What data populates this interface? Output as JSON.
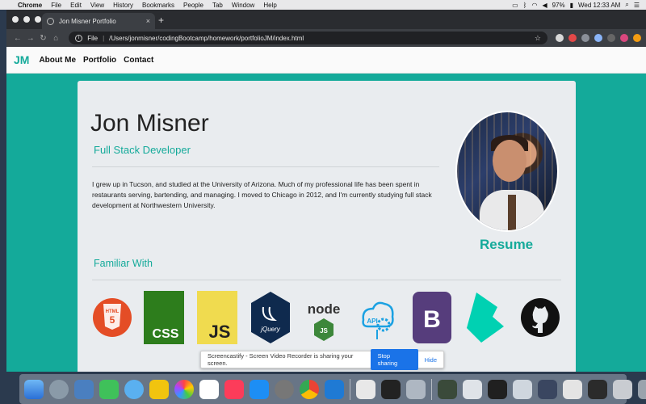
{
  "menubar": {
    "apple": "",
    "items": [
      "Chrome",
      "File",
      "Edit",
      "View",
      "History",
      "Bookmarks",
      "People",
      "Tab",
      "Window",
      "Help"
    ],
    "battery": "97%",
    "clock": "Wed 12:33 AM"
  },
  "browser": {
    "tab_title": "Jon Misner Portfolio",
    "tab_close": "×",
    "new_tab": "+",
    "url_scheme": "File",
    "url": "/Users/jonmisner/codingBootcamp/homework/portfolioJM/index.html"
  },
  "site": {
    "brand": "JM",
    "nav": [
      "About Me",
      "Portfolio",
      "Contact"
    ],
    "name": "Jon Misner",
    "role": "Full Stack Developer",
    "bio": "I grew up in Tucson, and studied at the University of Arizona. Much of my professional life has been spent in restaurants serving, bartending, and managing. I moved to Chicago in 2012, and I'm currently studying full stack development at Northwestern University.",
    "resume": "Resume",
    "familiar_heading": "Familiar With",
    "tech_icons": [
      {
        "icon": "html5-icon",
        "label": "HTML",
        "color": "#e44d26"
      },
      {
        "icon": "css-icon",
        "label": "CSS",
        "color": "#2d7d1c"
      },
      {
        "icon": "js-icon",
        "label": "JS",
        "color": "#f0db4f"
      },
      {
        "icon": "jquery-icon",
        "label": "jQuery",
        "color": "#0f2a4e"
      },
      {
        "icon": "nodejs-icon",
        "label": "node",
        "color": "#3c873a"
      },
      {
        "icon": "api-icon",
        "label": "API",
        "color": "#1ba1e2"
      },
      {
        "icon": "bootstrap-icon",
        "label": "B",
        "color": "#563d7c"
      },
      {
        "icon": "bulma-icon",
        "label": "",
        "color": "#00d1b2"
      },
      {
        "icon": "github-icon",
        "label": "",
        "color": "#111111"
      }
    ]
  },
  "notice": {
    "text": "Screencastify - Screen Video Recorder is sharing your screen.",
    "stop": "Stop sharing",
    "hide": "Hide"
  }
}
